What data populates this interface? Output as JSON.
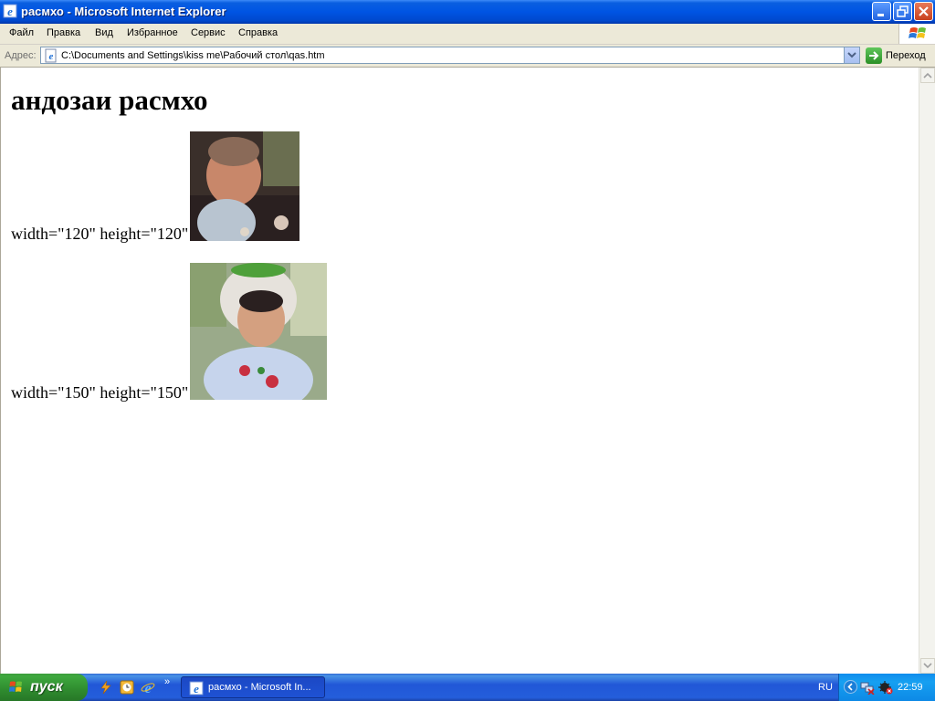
{
  "window": {
    "title": "расмхо - Microsoft Internet Explorer"
  },
  "menu": {
    "items": [
      "Файл",
      "Правка",
      "Вид",
      "Избранное",
      "Сервис",
      "Справка"
    ]
  },
  "address_bar": {
    "label": "Адрес:",
    "value": "C:\\Documents and Settings\\kiss me\\Рабочий стол\\qas.htm",
    "go_label": "Переход"
  },
  "page": {
    "heading": "андозаи расмхо",
    "images": [
      {
        "label": "width=\"120\" height=\"120\""
      },
      {
        "label": "width=\"150\" height=\"150\""
      }
    ]
  },
  "taskbar": {
    "start_label": "пуск",
    "more_indicator": "»",
    "task_button_label": "расмхо - Microsoft In...",
    "language": "RU",
    "clock": "22:59"
  },
  "colors": {
    "titlebar": "#0054e3",
    "taskbar": "#245edb",
    "start_button": "#3ea83e",
    "tray": "#0f8ced"
  }
}
